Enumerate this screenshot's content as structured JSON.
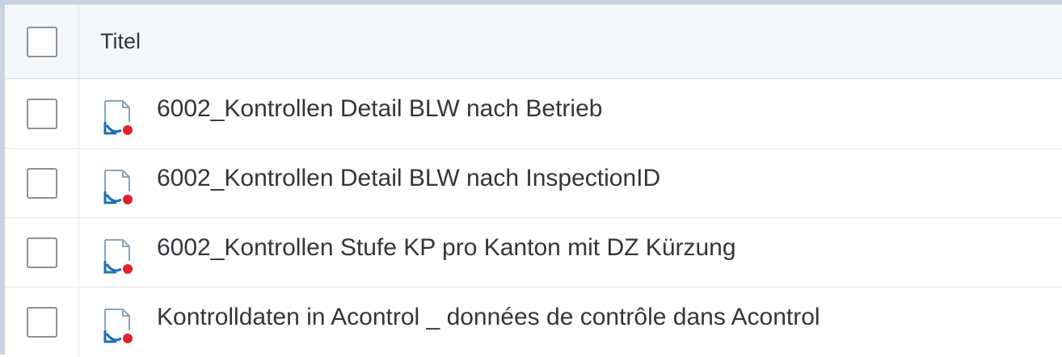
{
  "table": {
    "header": {
      "title_label": "Titel"
    },
    "rows": [
      {
        "title": "6002_Kontrollen Detail BLW nach Betrieb",
        "icon": "document-icon"
      },
      {
        "title": "6002_Kontrollen Detail BLW nach InspectionID",
        "icon": "document-icon"
      },
      {
        "title": "6002_Kontrollen Stufe KP pro Kanton mit DZ Kürzung",
        "icon": "document-icon"
      },
      {
        "title": "Kontrolldaten in Acontrol _ données de contrôle dans Acontrol",
        "icon": "document-icon"
      }
    ]
  },
  "colors": {
    "icon_blue": "#1b6fb8",
    "icon_red": "#e0202a",
    "icon_outline": "#8fa3b5"
  }
}
